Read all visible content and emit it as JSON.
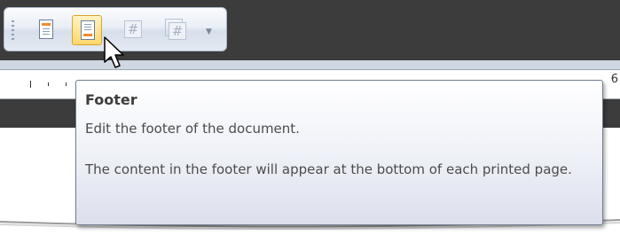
{
  "toolbar": {
    "buttons": [
      {
        "name": "header",
        "icon": "header-doc-icon"
      },
      {
        "name": "footer",
        "icon": "footer-doc-icon",
        "state": "hover"
      },
      {
        "name": "page-number",
        "icon": "hash-icon"
      },
      {
        "name": "page-count",
        "icon": "hash-stack-icon"
      },
      {
        "name": "more",
        "icon": "chevron-down-icon"
      }
    ]
  },
  "ruler": {
    "visible_number": "6"
  },
  "tooltip": {
    "title": "Footer",
    "description": "Edit the footer of the document.",
    "detail": "The content in the footer will appear at the bottom of each printed page."
  },
  "colors": {
    "highlight": "#ffd86b",
    "accent_bar": "#ef8b2c",
    "band": "#3c3c3c"
  }
}
